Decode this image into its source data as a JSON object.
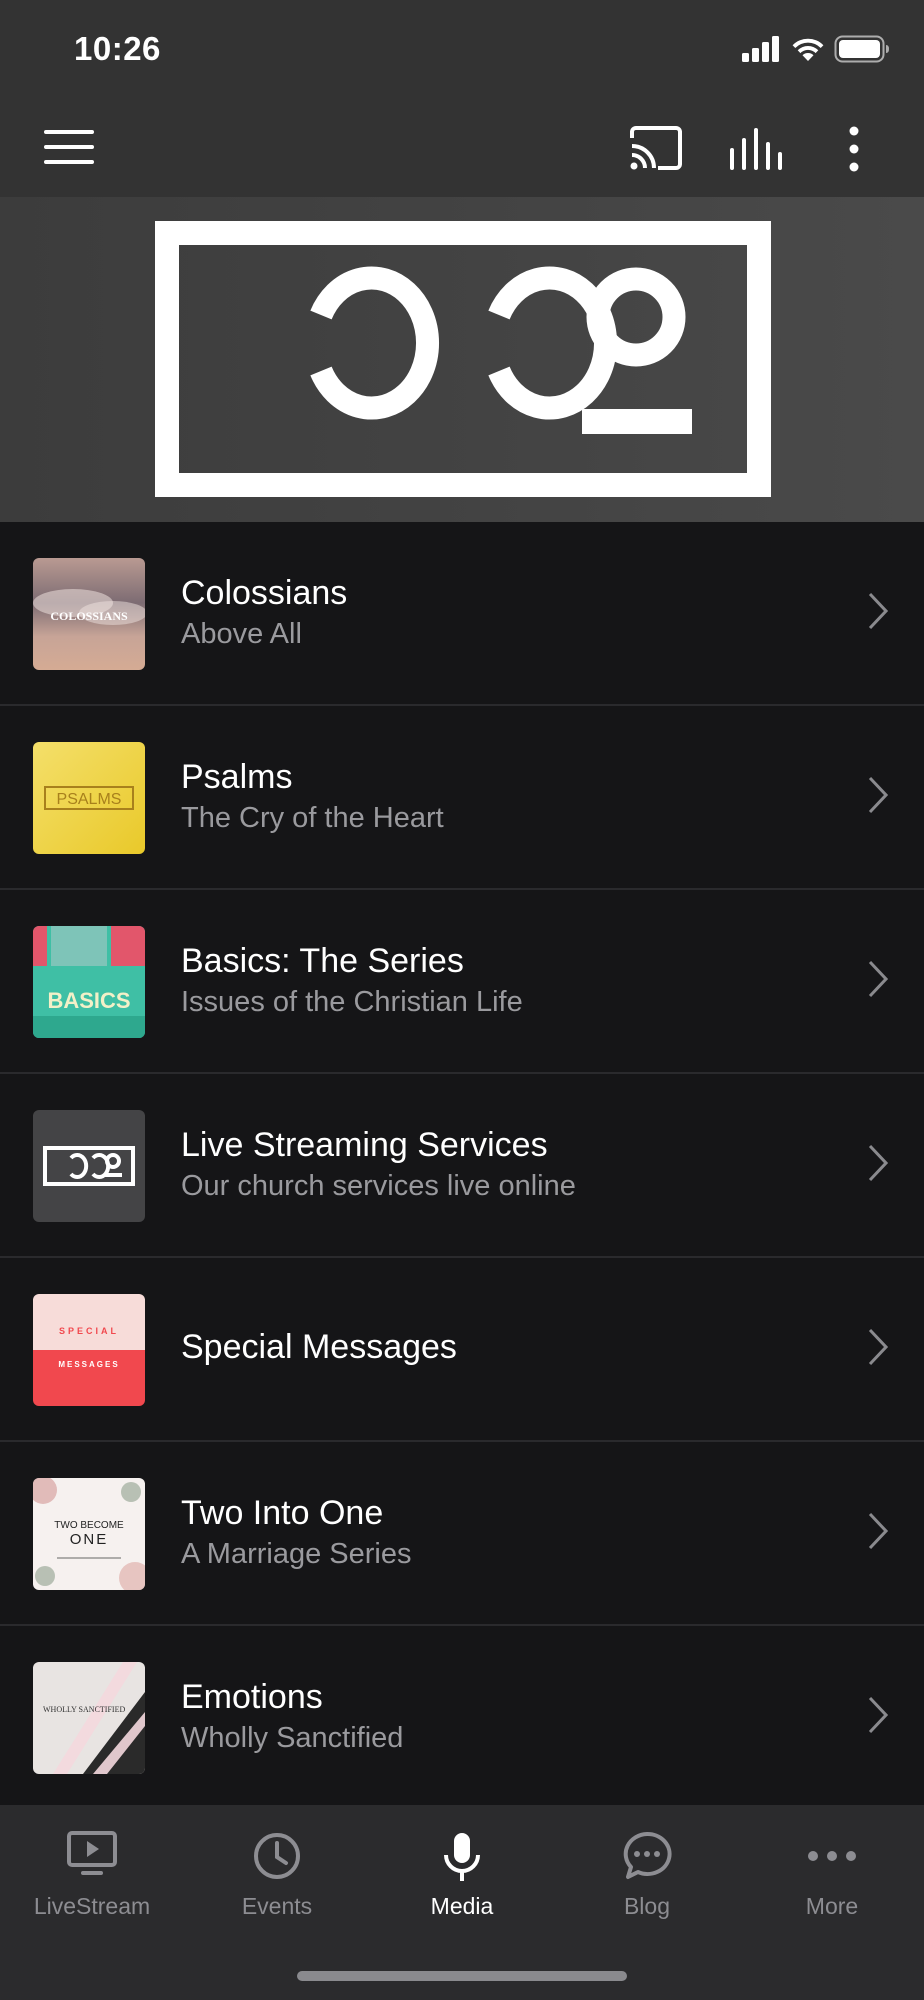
{
  "status_bar": {
    "time": "10:26"
  },
  "top_bar": {
    "menu_icon": "hamburger-menu-icon",
    "cast_icon": "cast-icon",
    "audio_icon": "audio-levels-icon",
    "more_icon": "vertical-dots-icon"
  },
  "hero": {
    "logo_text": "CCO",
    "background": "#444444"
  },
  "list": [
    {
      "title": "Colossians",
      "subtitle": "Above All",
      "thumb_text": "COLOSSIANS"
    },
    {
      "title": "Psalms",
      "subtitle": "The Cry of the Heart",
      "thumb_text": "PSALMS"
    },
    {
      "title": "Basics: The Series",
      "subtitle": "Issues of the Christian Life",
      "thumb_text": "BASICS"
    },
    {
      "title": "Live Streaming Services",
      "subtitle": "Our church services live online",
      "thumb_text": "CCO"
    },
    {
      "title": "Special Messages",
      "subtitle": "",
      "thumb_text_top": "SPECIAL",
      "thumb_text_bottom": "MESSAGES"
    },
    {
      "title": "Two Into One",
      "subtitle": "A Marriage Series",
      "thumb_text_top": "TWO BECOME",
      "thumb_text_bottom": "ONE"
    },
    {
      "title": "Emotions",
      "subtitle": "Wholly Sanctified",
      "thumb_text": "WHOLLY SANCTIFIED"
    }
  ],
  "tabs": [
    {
      "label": "LiveStream",
      "icon": "tv-play-icon",
      "active": false
    },
    {
      "label": "Events",
      "icon": "clock-icon",
      "active": false
    },
    {
      "label": "Media",
      "icon": "microphone-icon",
      "active": true
    },
    {
      "label": "Blog",
      "icon": "chat-bubble-icon",
      "active": false
    },
    {
      "label": "More",
      "icon": "horizontal-dots-icon",
      "active": false
    }
  ],
  "colors": {
    "background": "#151517",
    "toolbar": "#333333",
    "tab_bar": "#2b2b2d",
    "subtitle": "#9a9a9e",
    "divider": "#2a2a2d",
    "active_tab": "#ffffff",
    "inactive_tab": "#8d8d92"
  }
}
